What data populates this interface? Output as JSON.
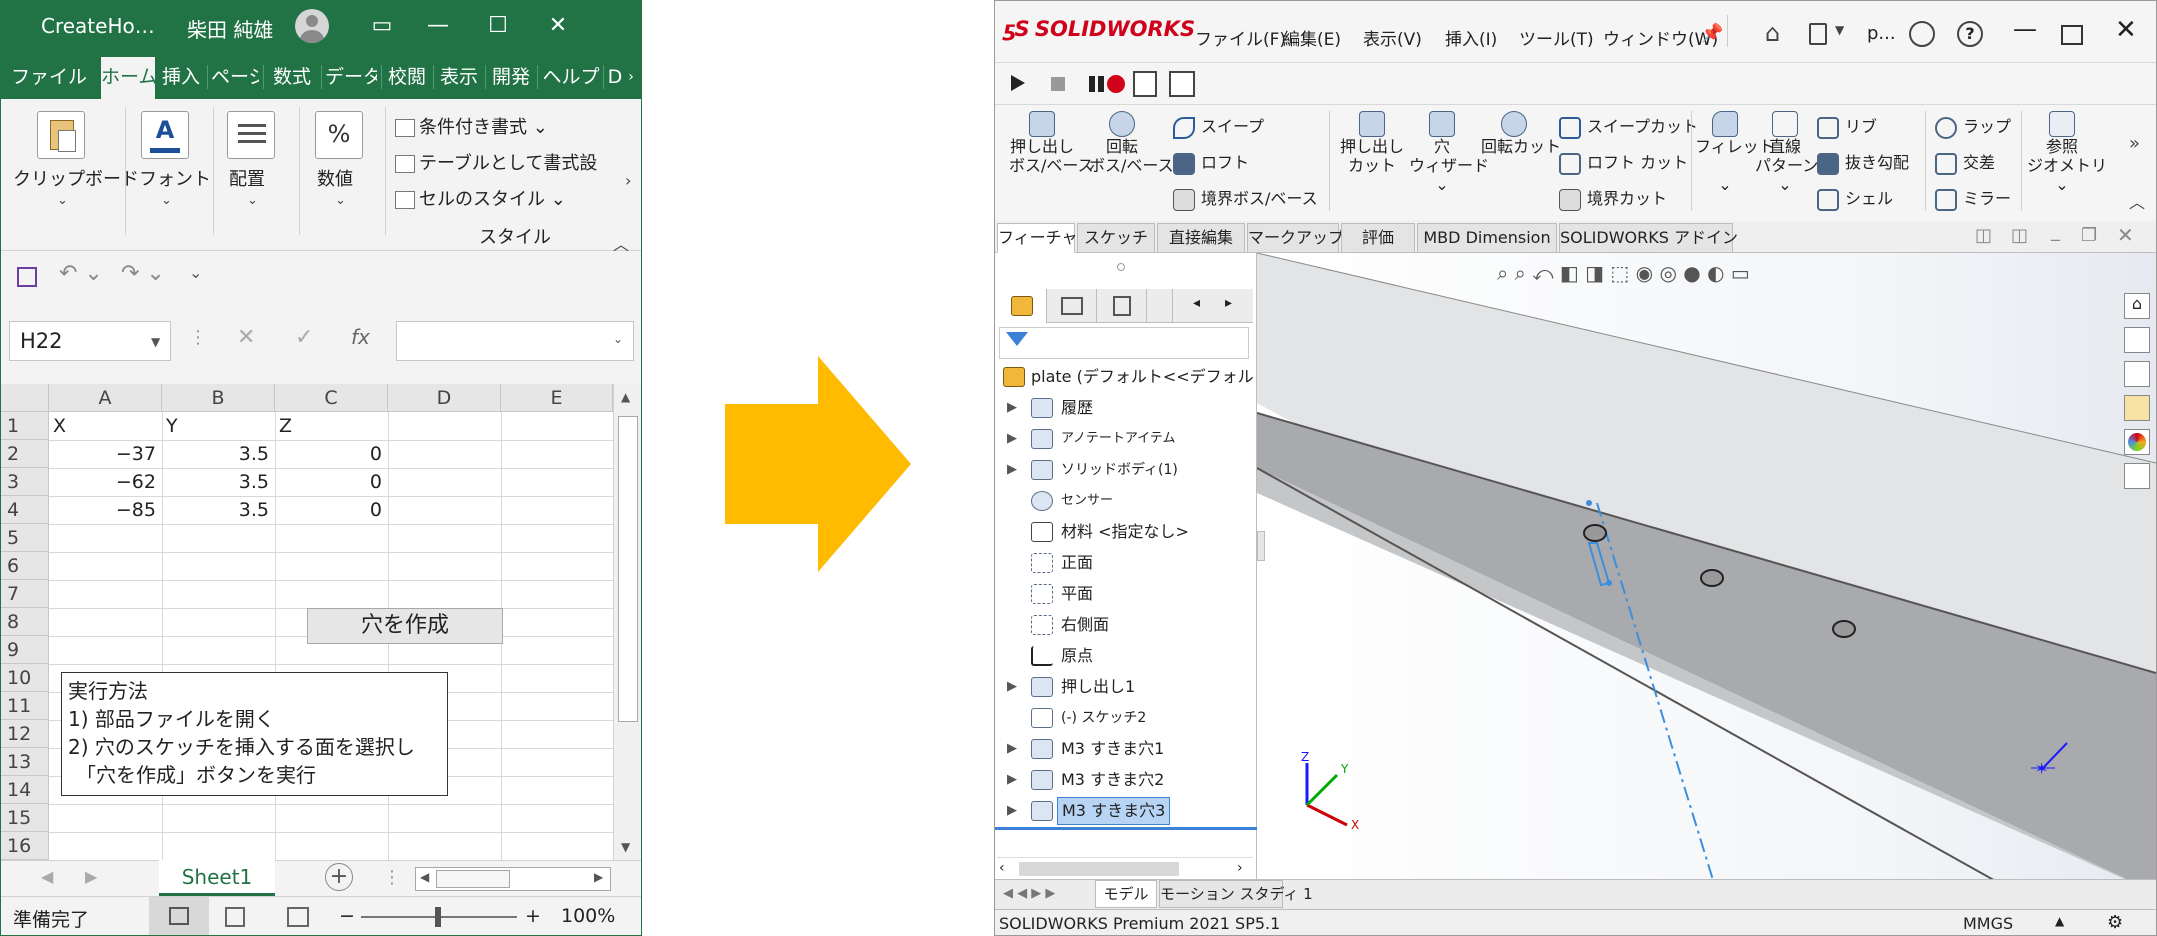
{
  "excel": {
    "window_title": "CreateHo…",
    "user_name": "柴田 純雄",
    "tabs": [
      "ファイル",
      "ホーム",
      "挿入",
      "ページ",
      "数式",
      "データ",
      "校閲",
      "表示",
      "開発",
      "ヘルプ",
      "D"
    ],
    "ribbon": {
      "clipboard": "クリップボード",
      "font": "フォント",
      "alignment": "配置",
      "number": "数値",
      "conditional_format": "条件付き書式",
      "format_as_table": "テーブルとして書式設",
      "cell_styles": "セルのスタイル",
      "styles_group": "スタイル"
    },
    "name_box": "H22",
    "fx_label": "fx",
    "columns": [
      "A",
      "B",
      "C",
      "D",
      "E"
    ],
    "rows": [
      "1",
      "2",
      "3",
      "4",
      "5",
      "6",
      "7",
      "8",
      "9",
      "10",
      "11",
      "12",
      "13",
      "14",
      "15",
      "16"
    ],
    "cells": {
      "a1": "X",
      "b1": "Y",
      "c1": "Z",
      "a2": "−37",
      "b2": "3.5",
      "c2": "0",
      "a3": "−62",
      "b3": "3.5",
      "c3": "0",
      "a4": "−85",
      "b4": "3.5",
      "c4": "0"
    },
    "create_hole_button": "穴を作成",
    "note": {
      "line1": "実行方法",
      "line2": "1) 部品ファイルを開く",
      "line3": "2) 穴のスケッチを挿入する面を選択し",
      "line4": "「穴を作成」ボタンを実行"
    },
    "sheet_tab": "Sheet1",
    "status_ready": "準備完了",
    "zoom": "100%"
  },
  "sw": {
    "logo": "SOLIDWORKS",
    "menus": [
      "ファイル(F)",
      "編集(E)",
      "表示(V)",
      "挿入(I)",
      "ツール(T)",
      "ウィンドウ(W)"
    ],
    "doc_short": "p...",
    "commands": {
      "extrude_boss": [
        "押し出し",
        "ボス/ベース"
      ],
      "revolve_boss": [
        "回転",
        "ボス/ベース"
      ],
      "sweep": "スイープ",
      "loft": "ロフト",
      "boundary_boss": "境界ボス/ベース",
      "extrude_cut": [
        "押し出し",
        "カット"
      ],
      "hole_wizard": [
        "穴",
        "ウィザード"
      ],
      "revolve_cut": "回転カット",
      "sweep_cut": "スイープカット",
      "loft_cut": "ロフト カット",
      "boundary_cut": "境界カット",
      "fillet": "フィレット",
      "linear_pattern": [
        "直線",
        "パターン"
      ],
      "rib": "リブ",
      "draft": "抜き勾配",
      "shell": "シェル",
      "wrap": "ラップ",
      "intersect": "交差",
      "mirror": "ミラー",
      "ref_geometry": [
        "参照",
        "ジオメトリ"
      ]
    },
    "tabs": [
      "フィーチャー",
      "スケッチ",
      "直接編集",
      "マークアップ",
      "評価",
      "MBD Dimension",
      "SOLIDWORKS アドイン"
    ],
    "tree": {
      "root": "plate (デフォルト<<デフォルト>_表示",
      "items": [
        "履歴",
        "アノテートアイテム",
        "ソリッドボディ(1)",
        "センサー",
        "材料 <指定なし>",
        "正面",
        "平面",
        "右側面",
        "原点",
        "押し出し1",
        "(-) スケッチ2",
        "M3 すきま穴1",
        "M3 すきま穴2",
        "M3 すきま穴3"
      ]
    },
    "bottom_tabs": [
      "モデル",
      "モーション スタディ 1"
    ],
    "status_left": "SOLIDWORKS Premium 2021 SP5.1",
    "status_units": "MMGS",
    "colors": {
      "brand_red": "#d0021b",
      "accent_blue": "#3b82d6"
    }
  },
  "arrow_color": "#ffbb00"
}
